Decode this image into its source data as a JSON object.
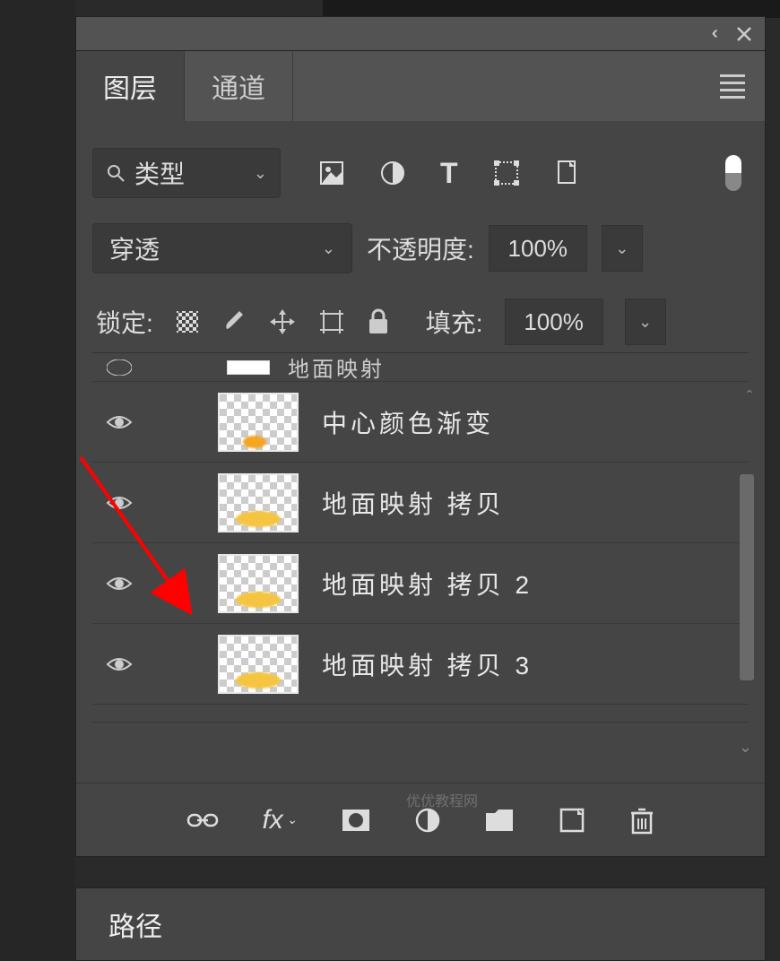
{
  "tabs": {
    "layers": "图层",
    "channels": "通道"
  },
  "filter": {
    "label": "类型"
  },
  "blend": {
    "mode": "穿透",
    "opacity_label": "不透明度:",
    "opacity_value": "100%"
  },
  "lock": {
    "label": "锁定:",
    "fill_label": "填充:",
    "fill_value": "100%"
  },
  "layers": [
    {
      "name": "地面映射",
      "cut": true
    },
    {
      "name": "中心颜色渐变",
      "blob": "orange"
    },
    {
      "name": "地面映射 拷贝",
      "blob": "yellow"
    },
    {
      "name": "地面映射 拷贝 2",
      "blob": "yellow"
    },
    {
      "name": "地面映射 拷贝 3",
      "blob": "yellow"
    }
  ],
  "footer": {
    "fx": "fx"
  },
  "panel2": {
    "label": "路径"
  },
  "watermark": "优优教程网"
}
